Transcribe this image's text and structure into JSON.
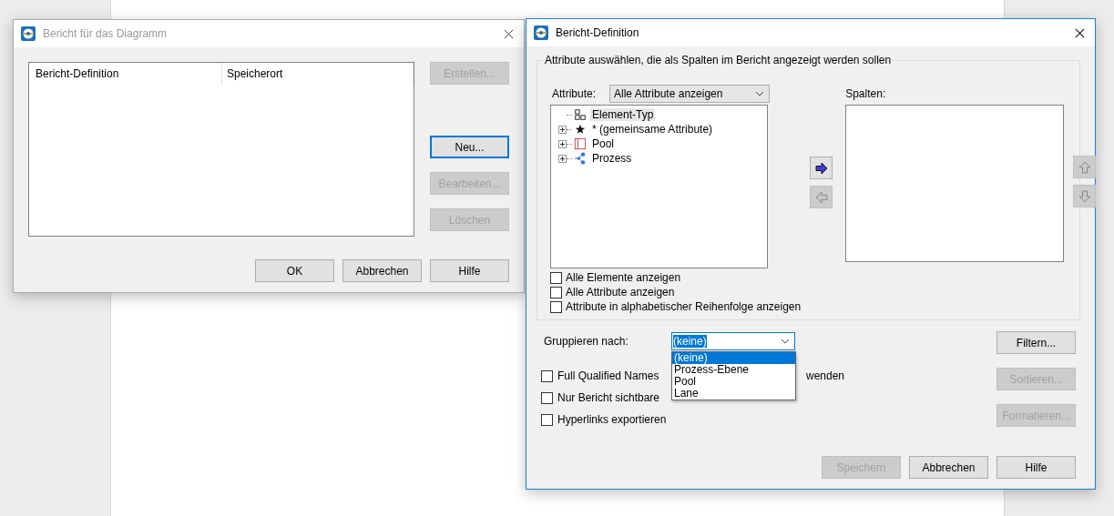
{
  "report_dialog": {
    "title": "Bericht für das Diagramm",
    "active": false,
    "columns": [
      "Bericht-Definition",
      "Speicherort"
    ],
    "side_buttons": [
      {
        "label": "Erstellen...",
        "disabled": true,
        "focused": false
      },
      {
        "label": "Neu...",
        "disabled": false,
        "focused": true
      },
      {
        "label": "Bearbeiten...",
        "disabled": true,
        "focused": false
      },
      {
        "label": "Löschen",
        "disabled": true,
        "focused": false
      }
    ],
    "buttons": [
      {
        "label": "OK",
        "disabled": false
      },
      {
        "label": "Abbrechen",
        "disabled": false
      },
      {
        "label": "Hilfe",
        "disabled": false
      }
    ]
  },
  "definition_dialog": {
    "title": "Bericht-Definition",
    "active": true,
    "group": {
      "legend": "Attribute auswählen, die als Spalten im Bericht angezeigt werden sollen",
      "attribute_label": "Attribute:",
      "attribute_filter": "Alle Attribute anzeigen",
      "tree": [
        {
          "label": "Element-Typ",
          "kind": "squares",
          "selected": true
        },
        {
          "label": "* (gemeinsame Attribute)",
          "kind": "star",
          "selected": false,
          "expanded": false
        },
        {
          "label": "Pool",
          "kind": "pool",
          "selected": false,
          "expanded": false
        },
        {
          "label": "Prozess",
          "kind": "nodes",
          "selected": false,
          "expanded": false
        }
      ],
      "columns_label": "Spalten:",
      "move_buttons": [
        {
          "kind": "right",
          "disabled": false
        },
        {
          "kind": "left",
          "disabled": true
        }
      ],
      "order_buttons": [
        {
          "kind": "up",
          "disabled": true
        },
        {
          "kind": "down",
          "disabled": true
        }
      ],
      "options": [
        {
          "label": "Alle Elemente anzeigen",
          "checked": false
        },
        {
          "label": "Alle Attribute anzeigen",
          "checked": false
        },
        {
          "label": "Attribute in alphabetischer Reihenfolge anzeigen",
          "checked": false
        }
      ]
    },
    "group_by": {
      "label": "Gruppieren nach:",
      "value": "(keine)",
      "open": true,
      "list": [
        {
          "label": "(keine)",
          "selected": true
        },
        {
          "label": "Prozess-Ebene",
          "selected": false
        },
        {
          "label": "Pool",
          "selected": false
        },
        {
          "label": "Lane",
          "selected": false
        }
      ]
    },
    "export_options": [
      {
        "parts": [
          "Full Qualified Names",
          "wenden"
        ],
        "checked": false
      },
      {
        "parts": [
          "Nur Bericht sichtbare"
        ],
        "checked": false
      },
      {
        "parts": [
          "Hyperlinks exportieren"
        ],
        "checked": false
      }
    ],
    "side_buttons": [
      {
        "label": "Filtern...",
        "disabled": false
      },
      {
        "label": "Sortieren...",
        "disabled": true
      },
      {
        "label": "Formatieren...",
        "disabled": true
      }
    ],
    "buttons": [
      {
        "label": "Speichern",
        "disabled": true
      },
      {
        "label": "Abbrechen",
        "disabled": false
      },
      {
        "label": "Hilfe",
        "disabled": false
      }
    ]
  }
}
